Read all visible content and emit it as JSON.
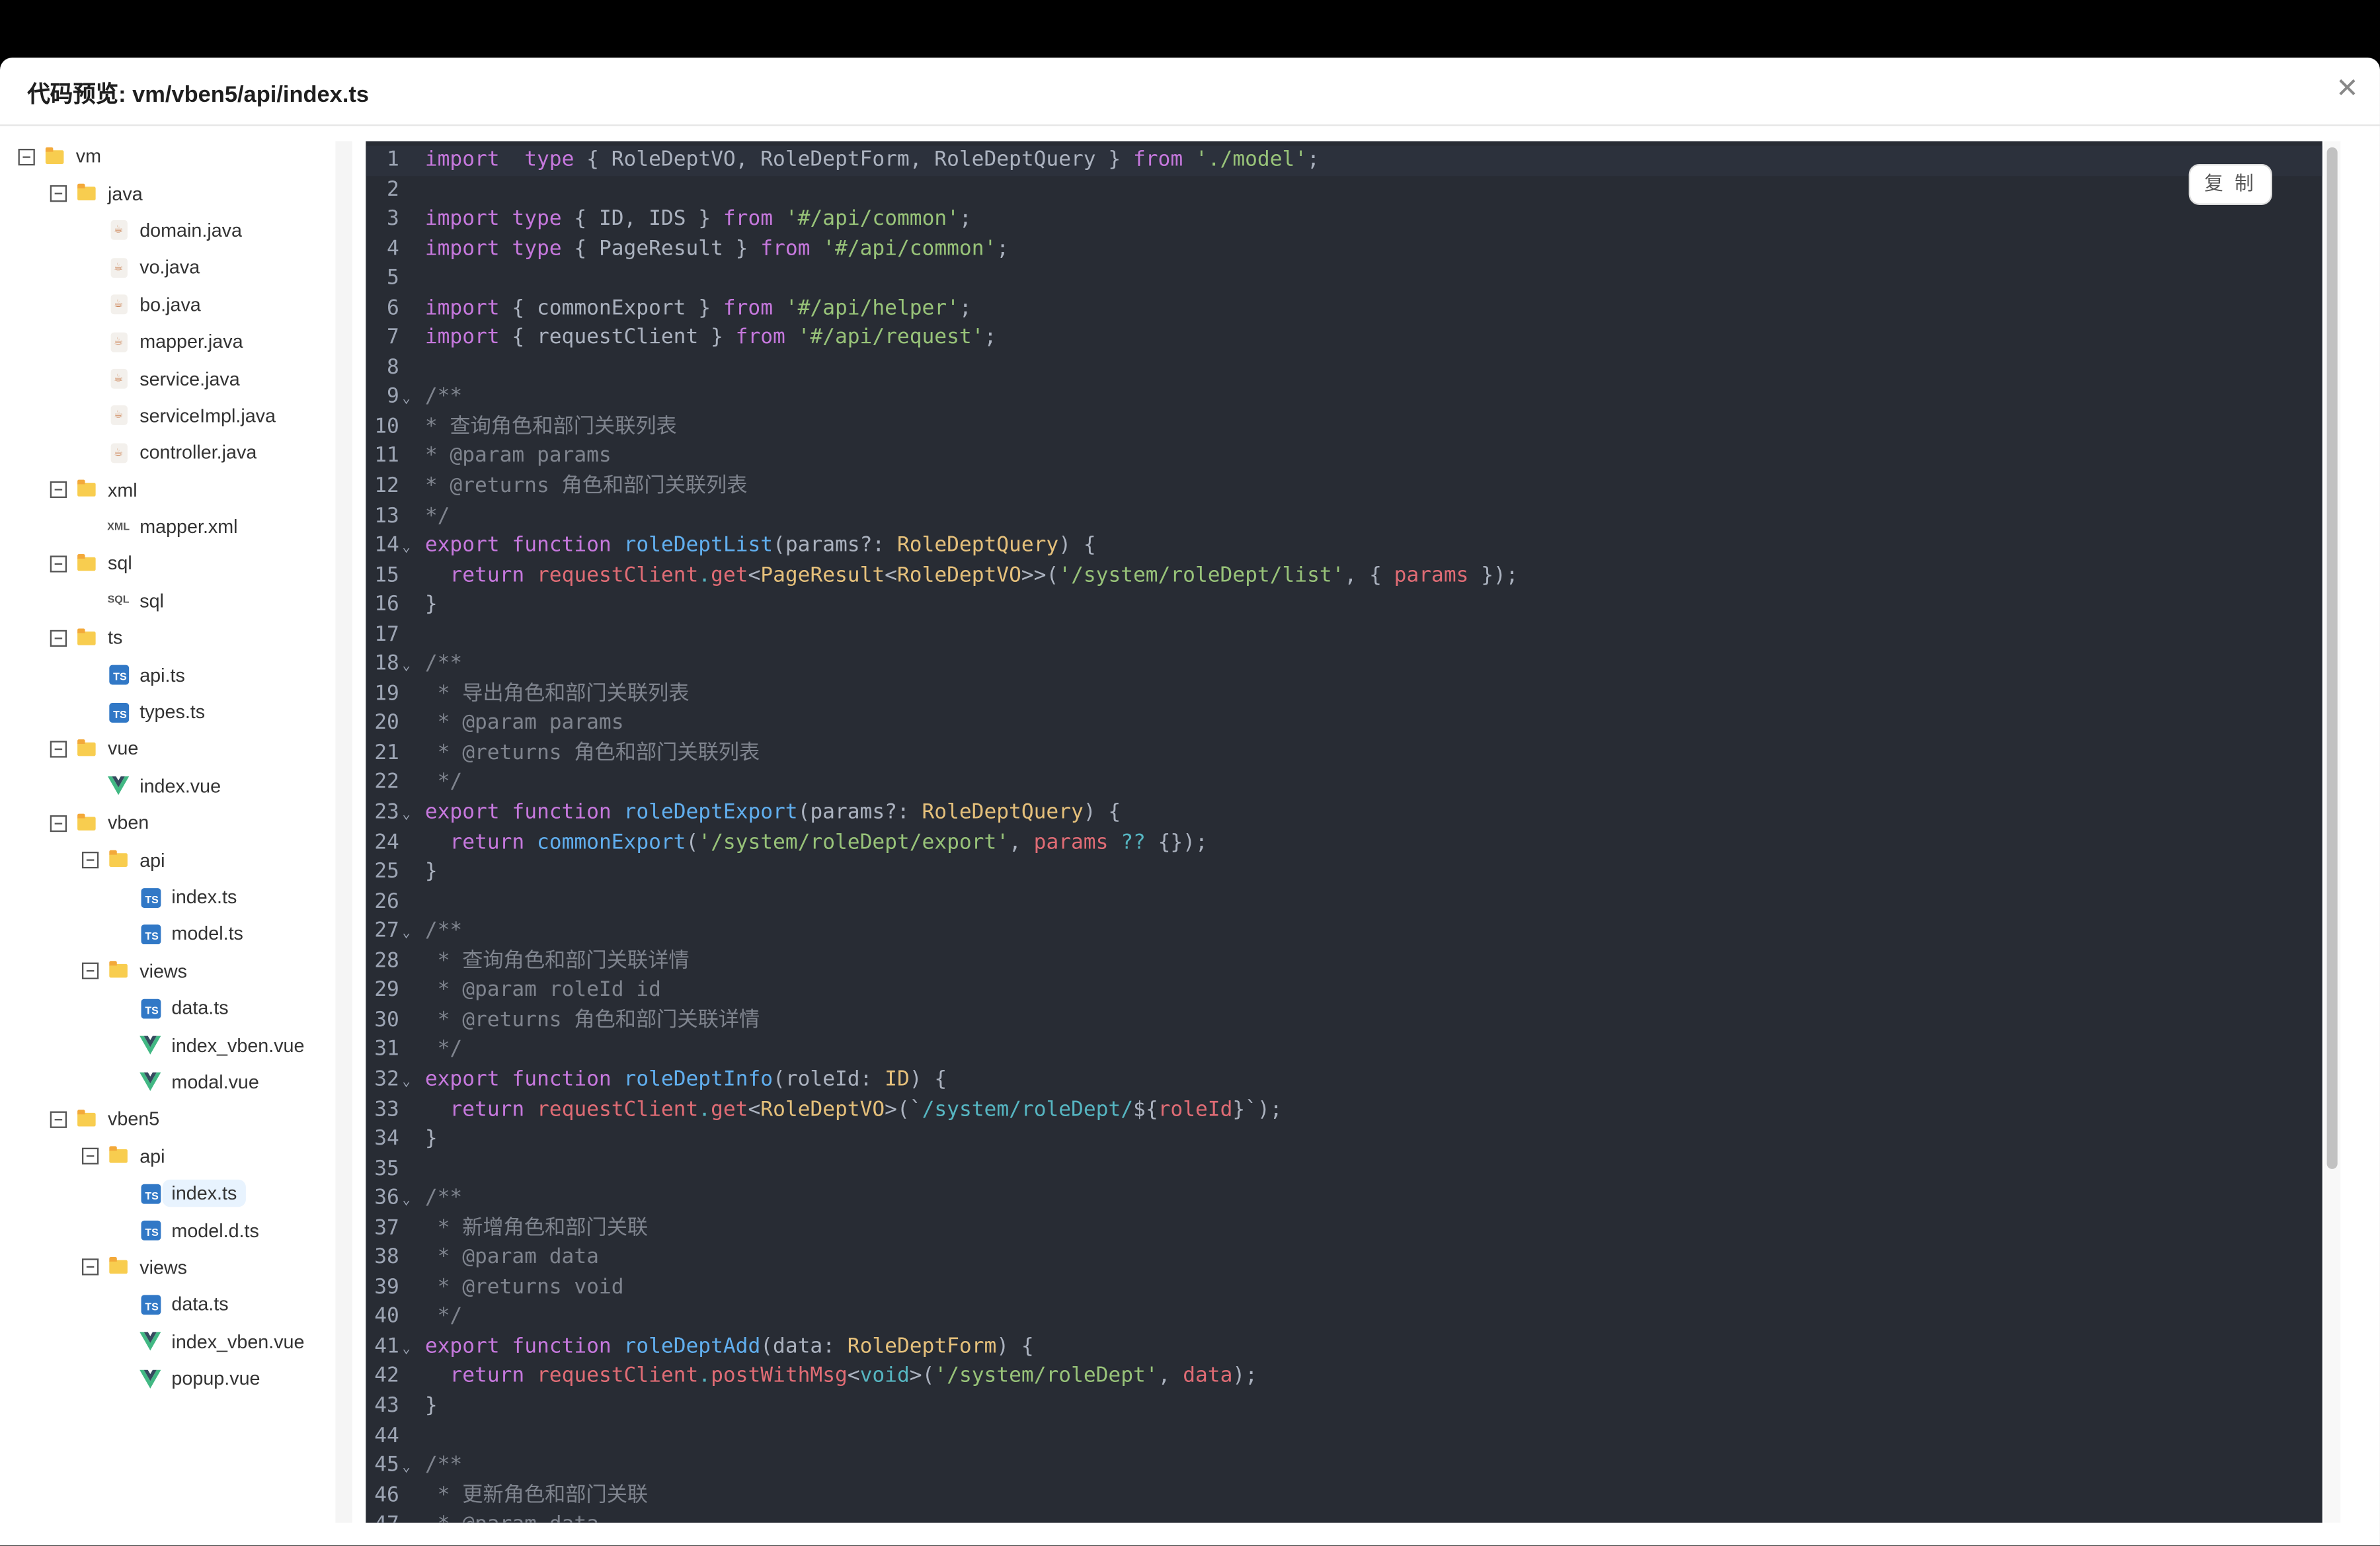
{
  "dialog": {
    "title": "代码预览: vm/vben5/api/index.ts",
    "close_icon": "close-icon",
    "copy_label": "复 制"
  },
  "colors": {
    "keyword": "#c678dd",
    "string": "#98c379",
    "function": "#61afef",
    "type": "#e5c07b",
    "variable": "#e06c75",
    "comment": "#7f848e",
    "template": "#56b6c2",
    "editor_bg": "#282c34",
    "selected_bg": "#e8f3fe"
  },
  "tree": [
    {
      "depth": 0,
      "kind": "folder",
      "label": "vm"
    },
    {
      "depth": 1,
      "kind": "folder",
      "label": "java"
    },
    {
      "depth": 2,
      "kind": "java",
      "label": "domain.java"
    },
    {
      "depth": 2,
      "kind": "java",
      "label": "vo.java"
    },
    {
      "depth": 2,
      "kind": "java",
      "label": "bo.java"
    },
    {
      "depth": 2,
      "kind": "java",
      "label": "mapper.java"
    },
    {
      "depth": 2,
      "kind": "java",
      "label": "service.java"
    },
    {
      "depth": 2,
      "kind": "java",
      "label": "serviceImpl.java"
    },
    {
      "depth": 2,
      "kind": "java",
      "label": "controller.java"
    },
    {
      "depth": 1,
      "kind": "folder",
      "label": "xml"
    },
    {
      "depth": 2,
      "kind": "xml",
      "label": "mapper.xml"
    },
    {
      "depth": 1,
      "kind": "folder",
      "label": "sql"
    },
    {
      "depth": 2,
      "kind": "sql",
      "label": "sql"
    },
    {
      "depth": 1,
      "kind": "folder",
      "label": "ts"
    },
    {
      "depth": 2,
      "kind": "ts",
      "label": "api.ts"
    },
    {
      "depth": 2,
      "kind": "ts",
      "label": "types.ts"
    },
    {
      "depth": 1,
      "kind": "folder",
      "label": "vue"
    },
    {
      "depth": 2,
      "kind": "vue",
      "label": "index.vue"
    },
    {
      "depth": 1,
      "kind": "folder",
      "label": "vben"
    },
    {
      "depth": 2,
      "kind": "folder",
      "label": "api"
    },
    {
      "depth": 3,
      "kind": "ts",
      "label": "index.ts"
    },
    {
      "depth": 3,
      "kind": "ts",
      "label": "model.ts"
    },
    {
      "depth": 2,
      "kind": "folder",
      "label": "views"
    },
    {
      "depth": 3,
      "kind": "ts",
      "label": "data.ts"
    },
    {
      "depth": 3,
      "kind": "vue",
      "label": "index_vben.vue"
    },
    {
      "depth": 3,
      "kind": "vue",
      "label": "modal.vue"
    },
    {
      "depth": 1,
      "kind": "folder",
      "label": "vben5"
    },
    {
      "depth": 2,
      "kind": "folder",
      "label": "api"
    },
    {
      "depth": 3,
      "kind": "ts",
      "label": "index.ts",
      "selected": true
    },
    {
      "depth": 3,
      "kind": "ts",
      "label": "model.d.ts"
    },
    {
      "depth": 2,
      "kind": "folder",
      "label": "views"
    },
    {
      "depth": 3,
      "kind": "ts",
      "label": "data.ts"
    },
    {
      "depth": 3,
      "kind": "vue",
      "label": "index_vben.vue"
    },
    {
      "depth": 3,
      "kind": "vue",
      "label": "popup.vue"
    }
  ],
  "code": [
    [
      [
        "k",
        "import"
      ],
      [
        "",
        "  "
      ],
      [
        "k",
        "type"
      ],
      [
        "",
        " { RoleDeptVO, RoleDeptForm, RoleDeptQuery } "
      ],
      [
        "k",
        "from"
      ],
      [
        "",
        " "
      ],
      [
        "s",
        "'./model'"
      ],
      [
        "",
        ";"
      ]
    ],
    [],
    [
      [
        "k",
        "import"
      ],
      [
        "",
        " "
      ],
      [
        "k",
        "type"
      ],
      [
        "",
        " { ID, IDS } "
      ],
      [
        "k",
        "from"
      ],
      [
        "",
        " "
      ],
      [
        "s",
        "'#/api/common'"
      ],
      [
        "",
        ";"
      ]
    ],
    [
      [
        "k",
        "import"
      ],
      [
        "",
        " "
      ],
      [
        "k",
        "type"
      ],
      [
        "",
        " { PageResult } "
      ],
      [
        "k",
        "from"
      ],
      [
        "",
        " "
      ],
      [
        "s",
        "'#/api/common'"
      ],
      [
        "",
        ";"
      ]
    ],
    [],
    [
      [
        "k",
        "import"
      ],
      [
        "",
        " { commonExport } "
      ],
      [
        "k",
        "from"
      ],
      [
        "",
        " "
      ],
      [
        "s",
        "'#/api/helper'"
      ],
      [
        "",
        ";"
      ]
    ],
    [
      [
        "k",
        "import"
      ],
      [
        "",
        " { requestClient } "
      ],
      [
        "k",
        "from"
      ],
      [
        "",
        " "
      ],
      [
        "s",
        "'#/api/request'"
      ],
      [
        "",
        ";"
      ]
    ],
    [],
    [
      [
        "c",
        "/**"
      ]
    ],
    [
      [
        "c",
        "* 查询角色和部门关联列表"
      ]
    ],
    [
      [
        "c",
        "* @param params"
      ]
    ],
    [
      [
        "c",
        "* @returns 角色和部门关联列表"
      ]
    ],
    [
      [
        "c",
        "*/"
      ]
    ],
    [
      [
        "k",
        "export"
      ],
      [
        "",
        " "
      ],
      [
        "k",
        "function"
      ],
      [
        "",
        " "
      ],
      [
        "f",
        "roleDeptList"
      ],
      [
        "",
        "(params?: "
      ],
      [
        "t",
        "RoleDeptQuery"
      ],
      [
        "",
        ") {"
      ]
    ],
    [
      [
        "",
        "  "
      ],
      [
        "k",
        "return"
      ],
      [
        "",
        " "
      ],
      [
        "v",
        "requestClient"
      ],
      [
        "q",
        "."
      ],
      [
        "v",
        "get"
      ],
      [
        "",
        "<"
      ],
      [
        "t",
        "PageResult"
      ],
      [
        "",
        "<"
      ],
      [
        "t",
        "RoleDeptVO"
      ],
      [
        "",
        ">>("
      ],
      [
        "s",
        "'/system/roleDept/list'"
      ],
      [
        "",
        ", { "
      ],
      [
        "v",
        "params"
      ],
      [
        "",
        " });"
      ]
    ],
    [
      [
        "",
        "}"
      ]
    ],
    [],
    [
      [
        "c",
        "/**"
      ]
    ],
    [
      [
        "c",
        " * 导出角色和部门关联列表"
      ]
    ],
    [
      [
        "c",
        " * @param params"
      ]
    ],
    [
      [
        "c",
        " * @returns 角色和部门关联列表"
      ]
    ],
    [
      [
        "c",
        " */"
      ]
    ],
    [
      [
        "k",
        "export"
      ],
      [
        "",
        " "
      ],
      [
        "k",
        "function"
      ],
      [
        "",
        " "
      ],
      [
        "f",
        "roleDeptExport"
      ],
      [
        "",
        "(params?: "
      ],
      [
        "t",
        "RoleDeptQuery"
      ],
      [
        "",
        ") {"
      ]
    ],
    [
      [
        "",
        "  "
      ],
      [
        "k",
        "return"
      ],
      [
        "",
        " "
      ],
      [
        "f",
        "commonExport"
      ],
      [
        "",
        "("
      ],
      [
        "s",
        "'/system/roleDept/export'"
      ],
      [
        "",
        ", "
      ],
      [
        "v",
        "params"
      ],
      [
        "",
        " "
      ],
      [
        "q",
        "??"
      ],
      [
        "",
        " {});"
      ]
    ],
    [
      [
        "",
        "}"
      ]
    ],
    [],
    [
      [
        "c",
        "/**"
      ]
    ],
    [
      [
        "c",
        " * 查询角色和部门关联详情"
      ]
    ],
    [
      [
        "c",
        " * @param roleId id"
      ]
    ],
    [
      [
        "c",
        " * @returns 角色和部门关联详情"
      ]
    ],
    [
      [
        "c",
        " */"
      ]
    ],
    [
      [
        "k",
        "export"
      ],
      [
        "",
        " "
      ],
      [
        "k",
        "function"
      ],
      [
        "",
        " "
      ],
      [
        "f",
        "roleDeptInfo"
      ],
      [
        "",
        "(roleId: "
      ],
      [
        "t",
        "ID"
      ],
      [
        "",
        ") {"
      ]
    ],
    [
      [
        "",
        "  "
      ],
      [
        "k",
        "return"
      ],
      [
        "",
        " "
      ],
      [
        "v",
        "requestClient"
      ],
      [
        "q",
        "."
      ],
      [
        "v",
        "get"
      ],
      [
        "",
        "<"
      ],
      [
        "t",
        "RoleDeptVO"
      ],
      [
        "",
        ">(`"
      ],
      [
        "q",
        "/system/roleDept/"
      ],
      [
        "",
        "${"
      ],
      [
        "v",
        "roleId"
      ],
      [
        "",
        "}`);"
      ]
    ],
    [
      [
        "",
        "}"
      ]
    ],
    [],
    [
      [
        "c",
        "/**"
      ]
    ],
    [
      [
        "c",
        " * 新增角色和部门关联"
      ]
    ],
    [
      [
        "c",
        " * @param data"
      ]
    ],
    [
      [
        "c",
        " * @returns void"
      ]
    ],
    [
      [
        "c",
        " */"
      ]
    ],
    [
      [
        "k",
        "export"
      ],
      [
        "",
        " "
      ],
      [
        "k",
        "function"
      ],
      [
        "",
        " "
      ],
      [
        "f",
        "roleDeptAdd"
      ],
      [
        "",
        "(data: "
      ],
      [
        "t",
        "RoleDeptForm"
      ],
      [
        "",
        ") {"
      ]
    ],
    [
      [
        "",
        "  "
      ],
      [
        "k",
        "return"
      ],
      [
        "",
        " "
      ],
      [
        "v",
        "requestClient"
      ],
      [
        "q",
        "."
      ],
      [
        "v",
        "postWithMsg"
      ],
      [
        "",
        "<"
      ],
      [
        "q",
        "void"
      ],
      [
        "",
        ">("
      ],
      [
        "s",
        "'/system/roleDept'"
      ],
      [
        "",
        ", "
      ],
      [
        "v",
        "data"
      ],
      [
        "",
        ");"
      ]
    ],
    [
      [
        "",
        "}"
      ]
    ],
    [],
    [
      [
        "c",
        "/**"
      ]
    ],
    [
      [
        "c",
        " * 更新角色和部门关联"
      ]
    ],
    [
      [
        "c",
        " * @param data"
      ]
    ]
  ],
  "fold_lines": [
    9,
    14,
    18,
    23,
    27,
    32,
    36,
    41,
    45
  ]
}
